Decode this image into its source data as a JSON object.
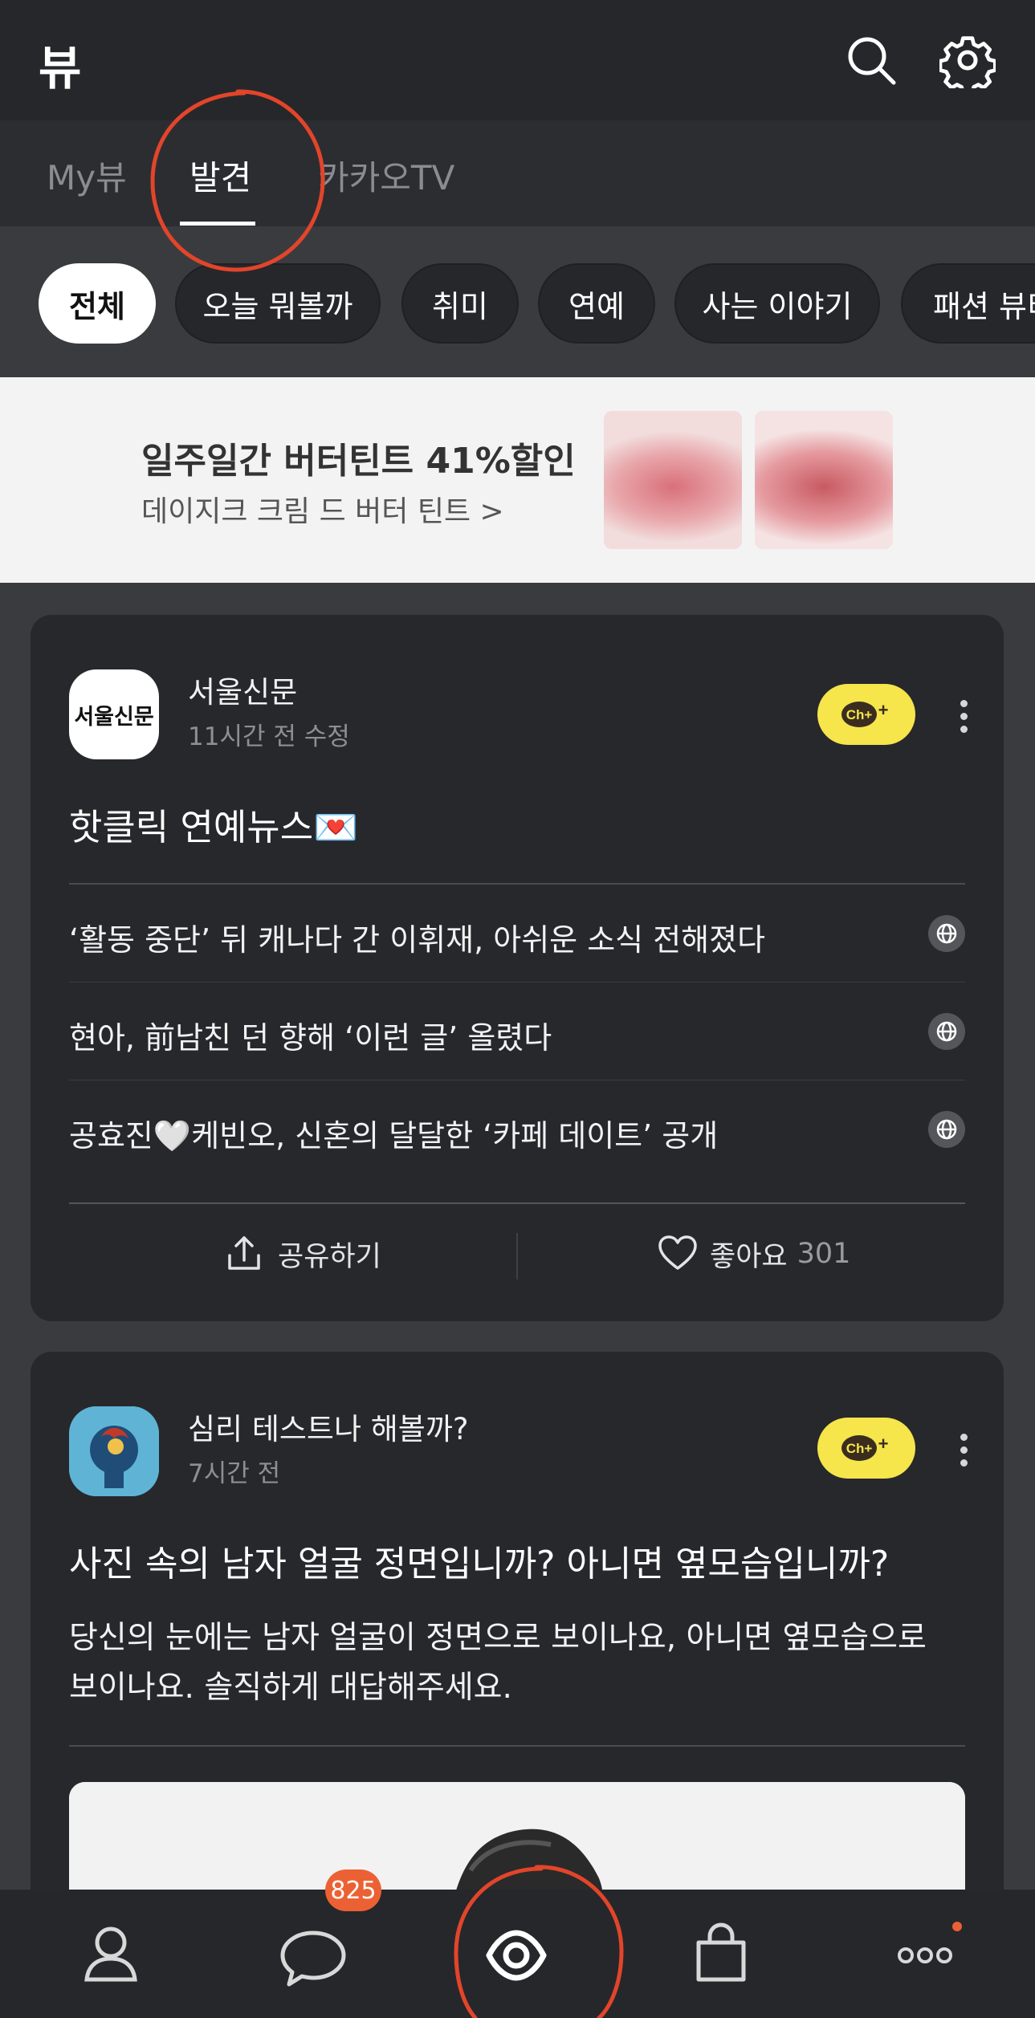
{
  "header": {
    "title": "뷰",
    "search_icon": "search-icon",
    "settings_icon": "gear-icon"
  },
  "tabs": [
    {
      "label": "My뷰",
      "active": false
    },
    {
      "label": "발견",
      "active": true
    },
    {
      "label": "카카오TV",
      "active": false
    }
  ],
  "chips": [
    {
      "label": "전체",
      "active": true
    },
    {
      "label": "오늘 뭐볼까",
      "active": false
    },
    {
      "label": "취미",
      "active": false
    },
    {
      "label": "연예",
      "active": false
    },
    {
      "label": "사는 이야기",
      "active": false
    },
    {
      "label": "패션 뷰티",
      "active": false
    }
  ],
  "ad": {
    "title": "일주일간 버터틴트 41%할인",
    "subtitle": "데이지크 크림 드 버터 틴트 >"
  },
  "card1": {
    "publisher": "서울신문",
    "avatar_text": "서울신문",
    "time": "11시간 전 수정",
    "channel_button": "Ch+",
    "headline": "핫클릭 연예뉴스💌",
    "news": [
      "‘활동 중단’ 뒤 캐나다 간 이휘재, 아쉬운 소식 전해졌다",
      "현아, 前남친 던 향해 ‘이런 글’ 올렸다",
      "공효진🤍케빈오, 신혼의 달달한 ‘카페 데이트’ 공개"
    ],
    "share_label": "공유하기",
    "like_label": "좋아요",
    "like_count": "301"
  },
  "card2": {
    "publisher": "심리 테스트나 해볼까?",
    "time": "7시간 전",
    "channel_button": "Ch+",
    "headline": "사진 속의 남자 얼굴 정면입니까? 아니면 옆모습입니까?",
    "body": "당신의 눈에는 남자 얼굴이 정면으로 보이나요, 아니면 옆모습으로 보이나요. 솔직하게 대답해주세요."
  },
  "bottom_nav": {
    "items": [
      "person-icon",
      "chat-icon",
      "view-icon",
      "shopping-bag-icon",
      "more-icon"
    ],
    "chat_badge": "825"
  },
  "colors": {
    "accent_yellow": "#f6e54b",
    "badge_orange": "#ec6133",
    "annotation_red": "#e2452a"
  }
}
